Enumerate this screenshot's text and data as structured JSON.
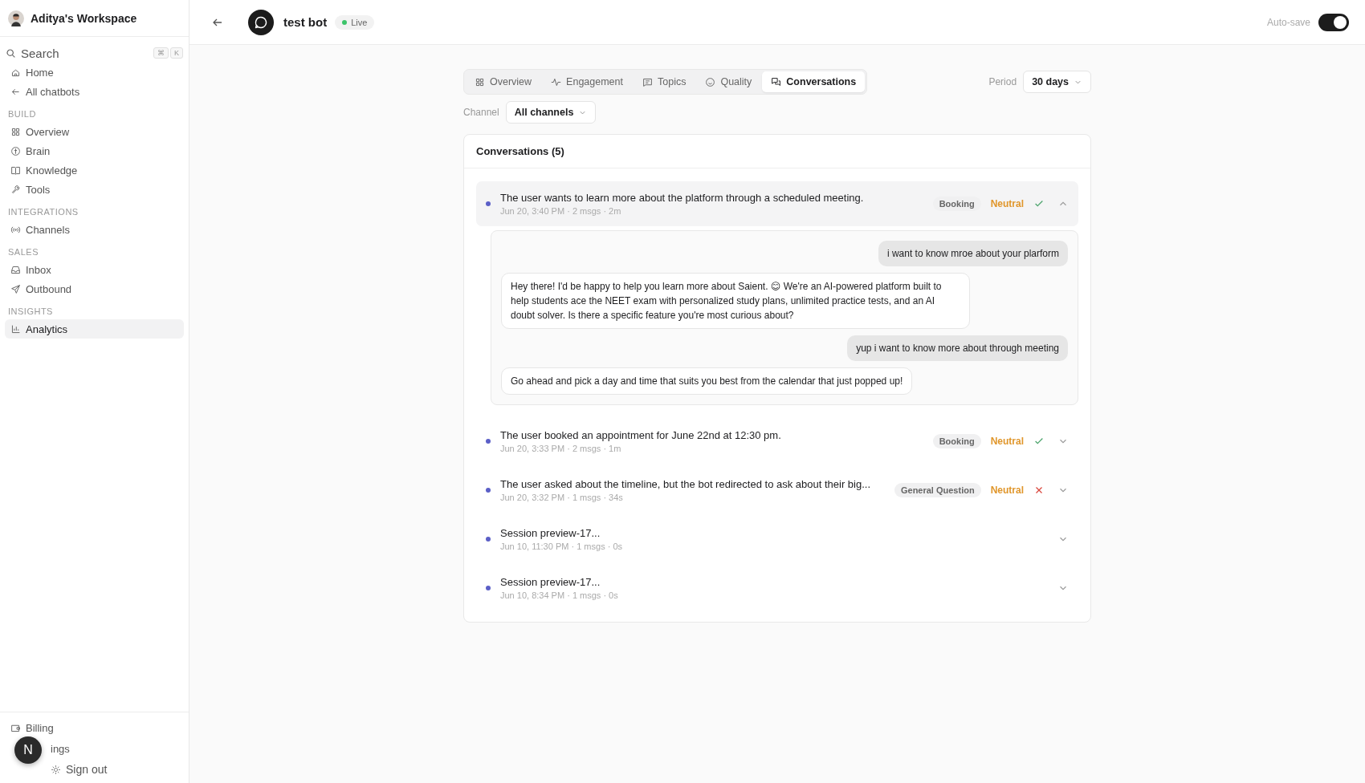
{
  "workspace": {
    "name": "Aditya's Workspace"
  },
  "sidebar": {
    "search": {
      "label": "Search",
      "keys": [
        "⌘",
        "K"
      ]
    },
    "nav": [
      {
        "kind": "item",
        "label": "Home",
        "selected": false
      },
      {
        "kind": "item",
        "label": "All chatbots",
        "selected": false
      },
      {
        "kind": "heading",
        "label": "BUILD"
      },
      {
        "kind": "item",
        "label": "Overview",
        "selected": false
      },
      {
        "kind": "item",
        "label": "Brain",
        "selected": false
      },
      {
        "kind": "item",
        "label": "Knowledge",
        "selected": false
      },
      {
        "kind": "item",
        "label": "Tools",
        "selected": false
      },
      {
        "kind": "heading",
        "label": "INTEGRATIONS"
      },
      {
        "kind": "item",
        "label": "Channels",
        "selected": false
      },
      {
        "kind": "heading",
        "label": "SALES"
      },
      {
        "kind": "item",
        "label": "Inbox",
        "selected": false
      },
      {
        "kind": "item",
        "label": "Outbound",
        "selected": false
      },
      {
        "kind": "heading",
        "label": "INSIGHTS"
      },
      {
        "kind": "item",
        "label": "Analytics",
        "selected": true
      }
    ],
    "bottom": [
      "Billing",
      "ings",
      "Sign out"
    ],
    "floating_avatar": "N"
  },
  "header": {
    "title": "test bot",
    "status": "Live",
    "autosave": {
      "label": "Auto-save",
      "on": true
    }
  },
  "tabs": [
    {
      "label": "Overview",
      "selected": false
    },
    {
      "label": "Engagement",
      "selected": false
    },
    {
      "label": "Topics",
      "selected": false
    },
    {
      "label": "Quality",
      "selected": false
    },
    {
      "label": "Conversations",
      "selected": true
    }
  ],
  "period": {
    "label": "Period",
    "value": "30 days"
  },
  "channel": {
    "label": "Channel",
    "value": "All channels"
  },
  "conversations": {
    "title": "Conversations (5)",
    "items": [
      {
        "summary": "The user wants to learn more about the platform through a scheduled meeting.",
        "meta": "Jun 20, 3:40 PM · 2 msgs · 2m",
        "tag": "Booking",
        "sentiment": "Neutral",
        "resolved": true,
        "expanded": true,
        "messages": [
          {
            "outgoing": true,
            "text": "i want to know mroe about your plarform"
          },
          {
            "outgoing": false,
            "text": "Hey there! I'd be happy to help you learn more about Saient. 😊 We're an AI-powered platform built to help students ace the NEET exam with personalized study plans, unlimited practice tests, and an AI doubt solver. Is there a specific feature you're most curious about?"
          },
          {
            "outgoing": true,
            "text": "yup i want to know more about through meeting"
          },
          {
            "outgoing": false,
            "text": "Go ahead and pick a day and time that suits you best from the calendar that just popped up!"
          }
        ]
      },
      {
        "summary": "The user booked an appointment for June 22nd at 12:30 pm.",
        "meta": "Jun 20, 3:33 PM · 2 msgs · 1m",
        "tag": "Booking",
        "sentiment": "Neutral",
        "resolved": true,
        "expanded": false
      },
      {
        "summary": "The user asked about the timeline, but the bot redirected to ask about their big...",
        "meta": "Jun 20, 3:32 PM · 1 msgs · 34s",
        "tag": "General Question",
        "sentiment": "Neutral",
        "resolved": false,
        "expanded": false
      },
      {
        "summary": "Session preview-17...",
        "meta": "Jun 10, 11:30 PM · 1 msgs · 0s",
        "expanded": false
      },
      {
        "summary": "Session preview-17...",
        "meta": "Jun 10, 8:34 PM · 1 msgs · 0s",
        "expanded": false
      }
    ]
  }
}
